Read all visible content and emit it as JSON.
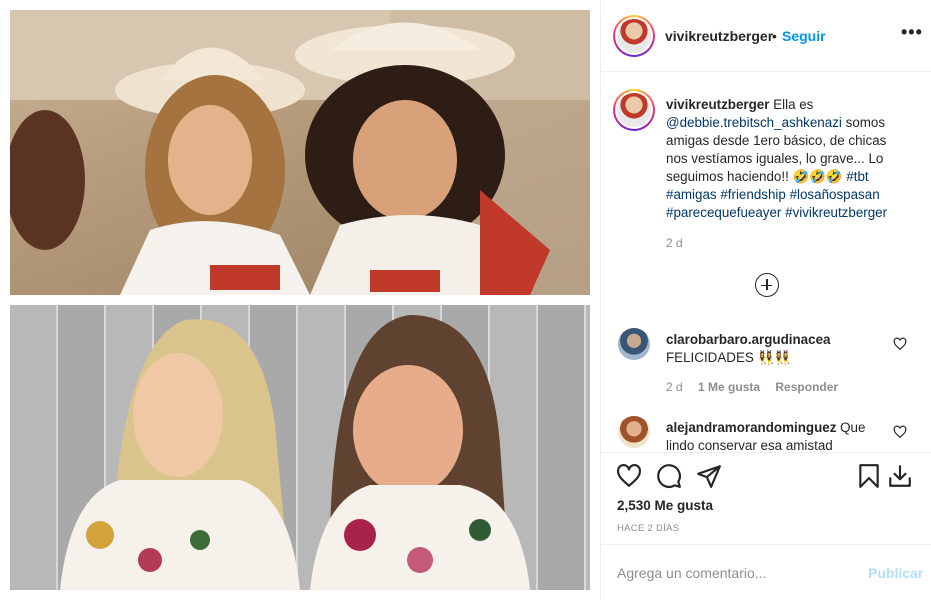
{
  "header": {
    "username": "vivikreutzberger",
    "separator": "•",
    "follow_label": "Seguir",
    "more_label": "•••"
  },
  "caption": {
    "username": "vivikreutzberger",
    "text_before": "Ella es",
    "mention": "@debbie.trebitsch_ashkenazi",
    "text_after": "somos amigas desde 1ero básico, de chicas nos vestíamos iguales, lo grave... Lo seguimos haciendo!! 🤣🤣🤣",
    "hashtags": "#tbt #amigas #friendship #losañospasan #parecequefueayer #vivikreutzberger",
    "time": "2 d"
  },
  "comments": [
    {
      "username": "clarobarbaro.argudinacea",
      "text": "FELICIDADES 👯‍♀️👯‍♀️",
      "time": "2 d",
      "likes": "1 Me gusta",
      "reply_label": "Responder"
    },
    {
      "username": "alejandramorandominguez",
      "text": "Que lindo conservar esa amistad"
    }
  ],
  "actions": {
    "likes_count": "2,530 Me gusta",
    "posted_ago": "HACE 2 DÍAS"
  },
  "add_comment": {
    "placeholder": "Agrega un comentario...",
    "post_label": "Publicar"
  },
  "icons": {
    "load_more": "plus-circle-icon",
    "like": "heart-icon",
    "comment": "comment-bubble-icon",
    "share": "paper-plane-icon",
    "save": "bookmark-icon",
    "download": "download-icon"
  },
  "colors": {
    "follow_blue": "#0095f6",
    "link_blue": "#00376b",
    "muted": "#8e8e8e",
    "publish_disabled": "#b2dffc"
  }
}
